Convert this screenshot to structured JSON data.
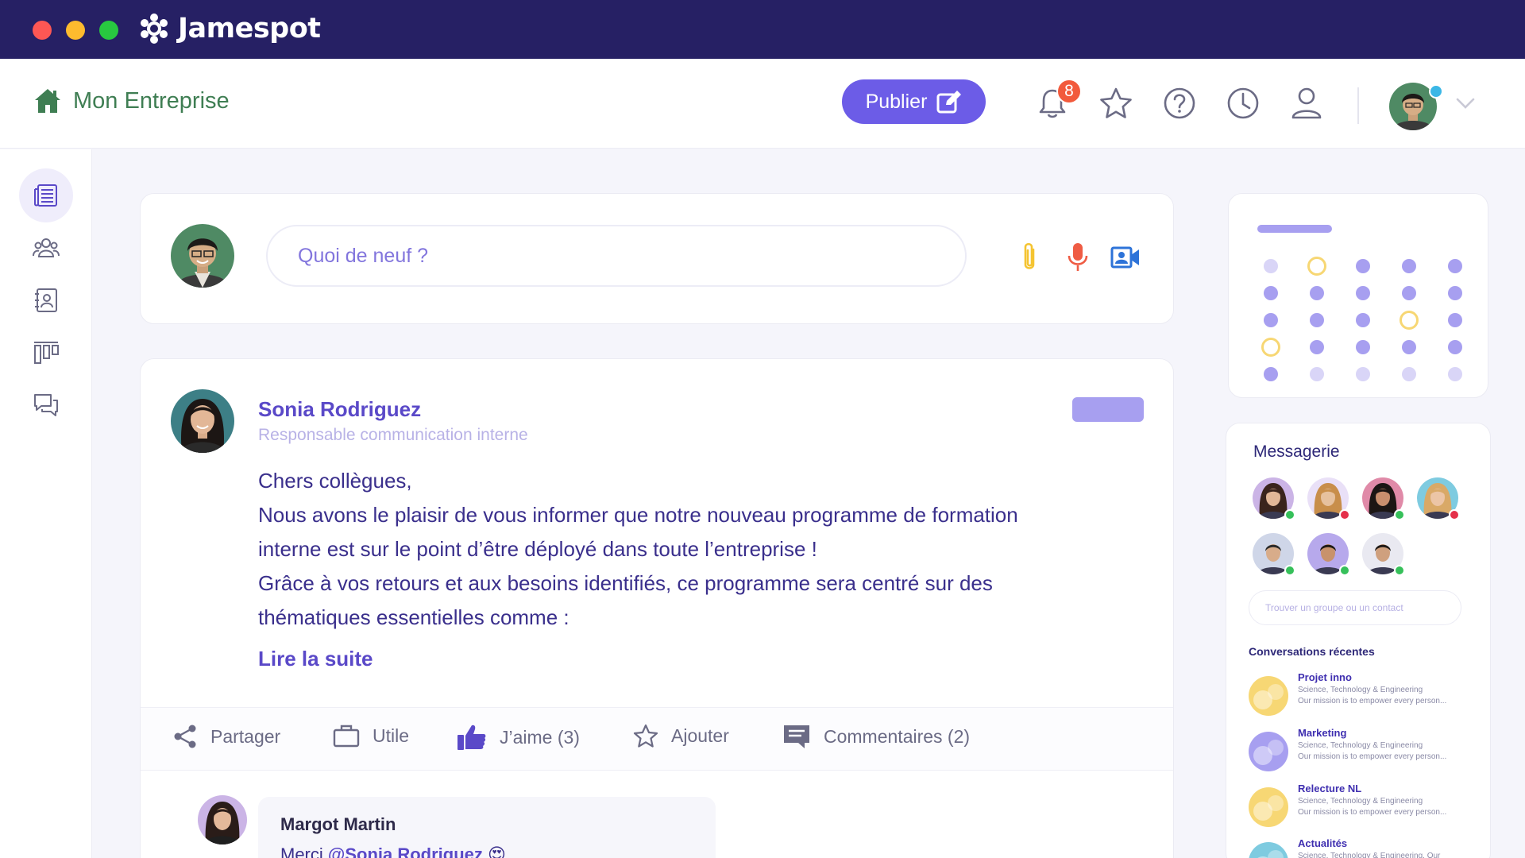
{
  "window": {
    "app_name": "Jamespot",
    "controls": [
      "close",
      "minimize",
      "maximize"
    ]
  },
  "header": {
    "home_label": "Mon Entreprise",
    "publish_label": "Publier",
    "notification_count": "8",
    "icons": [
      "bell-icon",
      "star-icon",
      "help-icon",
      "history-icon",
      "user-icon"
    ]
  },
  "sidebar": {
    "items": [
      {
        "icon": "news-feed-icon",
        "active": true
      },
      {
        "icon": "people-icon",
        "active": false
      },
      {
        "icon": "directory-icon",
        "active": false
      },
      {
        "icon": "boards-icon",
        "active": false
      },
      {
        "icon": "chat-icon",
        "active": false
      }
    ]
  },
  "composer": {
    "placeholder": "Quoi de neuf ?",
    "attach_icon": "paperclip-icon",
    "audio_icon": "microphone-icon",
    "video_icon": "video-icon"
  },
  "post": {
    "author": "Sonia Rodriguez",
    "role": "Responsable communication interne",
    "lines": [
      "Chers collègues,",
      "Nous avons le plaisir de vous informer que notre nouveau programme de formation",
      "interne est sur le point d’être déployé dans toute l’entreprise !",
      "Grâce à vos retours et aux besoins identifiés, ce programme sera centré sur des",
      "thématiques essentielles comme :"
    ],
    "read_more": "Lire la suite",
    "actions": {
      "share": "Partager",
      "useful": "Utile",
      "like": "J’aime (3)",
      "add": "Ajouter",
      "comments": "Commentaires (2)"
    },
    "comment": {
      "author": "Margot Martin",
      "prefix": "Merci ",
      "mention": "@Sonia Rodriguez",
      "emoji": "😍"
    }
  },
  "messaging": {
    "title": "Messagerie",
    "contacts": [
      {
        "status": "online",
        "color": "#36c05a"
      },
      {
        "status": "busy",
        "color": "#e5304a"
      },
      {
        "status": "online",
        "color": "#36c05a"
      },
      {
        "status": "busy",
        "color": "#e5304a"
      },
      {
        "status": "online",
        "color": "#36c05a"
      },
      {
        "status": "online",
        "color": "#36c05a"
      },
      {
        "status": "online",
        "color": "#36c05a"
      }
    ],
    "search_placeholder": "Trouver un groupe ou un contact",
    "recent_title": "Conversations récentes",
    "conversations": [
      {
        "name": "Projet inno",
        "subtitle": "Science, Technology & Engineering",
        "desc": "Our mission is to empower every person...",
        "color": "#f7d774"
      },
      {
        "name": "Marketing",
        "subtitle": "Science, Technology & Engineering",
        "desc": "Our mission is to empower every person...",
        "color": "#a79ff0"
      },
      {
        "name": "Relecture NL",
        "subtitle": "Science, Technology & Engineering",
        "desc": "Our mission is to empower every person...",
        "color": "#f7d774"
      },
      {
        "name": "Actualités",
        "subtitle": "Science, Technology & Engineering, Our",
        "desc": "",
        "color": "#7ecbe0"
      }
    ]
  },
  "colors": {
    "titlebar": "#262064",
    "accent": "#6c5ce7",
    "home_green": "#3f7e53",
    "notification_badge": "#f25a3c",
    "author_purple": "#5a49c8"
  }
}
